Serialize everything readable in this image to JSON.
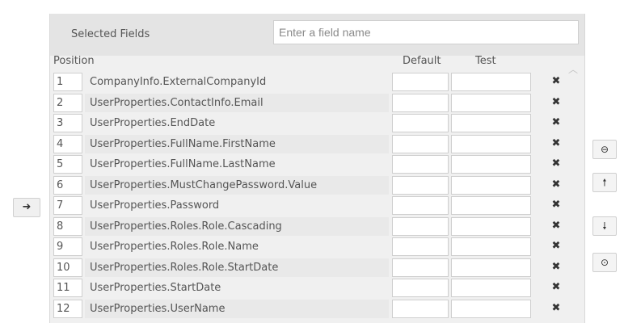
{
  "header": {
    "title": "Selected Fields",
    "search_placeholder": "Enter a field name"
  },
  "columns": {
    "position": "Position",
    "default": "Default",
    "test": "Test"
  },
  "rows": [
    {
      "position": "1",
      "field": "CompanyInfo.ExternalCompanyId"
    },
    {
      "position": "2",
      "field": "UserProperties.ContactInfo.Email"
    },
    {
      "position": "3",
      "field": "UserProperties.EndDate"
    },
    {
      "position": "4",
      "field": "UserProperties.FullName.FirstName"
    },
    {
      "position": "5",
      "field": "UserProperties.FullName.LastName"
    },
    {
      "position": "6",
      "field": "UserProperties.MustChangePassword.Value"
    },
    {
      "position": "7",
      "field": "UserProperties.Password"
    },
    {
      "position": "8",
      "field": "UserProperties.Roles.Role.Cascading"
    },
    {
      "position": "9",
      "field": "UserProperties.Roles.Role.Name"
    },
    {
      "position": "10",
      "field": "UserProperties.Roles.Role.StartDate"
    },
    {
      "position": "11",
      "field": "UserProperties.StartDate"
    },
    {
      "position": "12",
      "field": "UserProperties.UserName"
    }
  ],
  "icons": {
    "remove": "x-icon",
    "scroll_up": "chevron-up-icon",
    "move_right": "arrow-right-icon",
    "side_buttons": [
      "minus-circle-icon",
      "arrow-up-icon",
      "arrow-down-icon",
      "circle-icon"
    ]
  },
  "glyphs": {
    "remove": "✖",
    "scroll_up": "︿",
    "move_right": "➜",
    "remove_selected": "⊖",
    "move_up": "🠕",
    "move_down": "🠗",
    "clear": "⊙"
  }
}
